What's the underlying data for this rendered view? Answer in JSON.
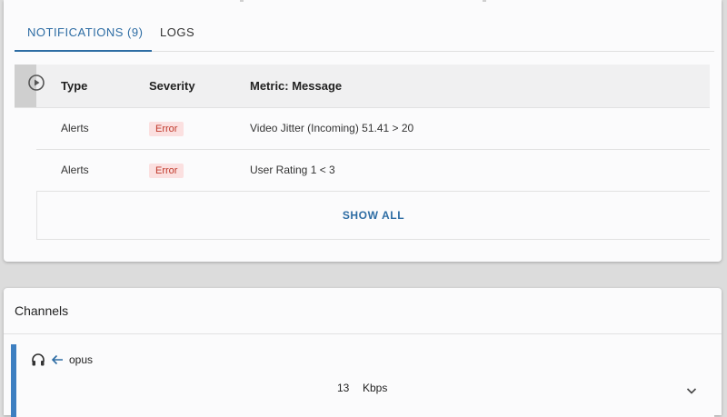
{
  "tabs": [
    {
      "label": "NOTIFICATIONS (9)",
      "active": true
    },
    {
      "label": "LOGS",
      "active": false
    }
  ],
  "table": {
    "headers": {
      "type": "Type",
      "severity": "Severity",
      "message": "Metric: Message"
    },
    "rows": [
      {
        "type": "Alerts",
        "severity": "Error",
        "message": "Video Jitter (Incoming) 51.41 > 20"
      },
      {
        "type": "Alerts",
        "severity": "Error",
        "message": "User Rating 1 < 3"
      }
    ],
    "show_all": "SHOW ALL"
  },
  "channels": {
    "title": "Channels",
    "items": [
      {
        "icon": "headphones-icon",
        "direction_icon": "arrow-left-icon",
        "codec": "opus",
        "bitrate_value": "13",
        "bitrate_unit": "Kbps"
      }
    ]
  },
  "colors": {
    "accent": "#2e6da4",
    "error_badge_bg": "#fbe0e0",
    "error_badge_text": "#c0392b",
    "channel_bar": "#3d7fc1"
  }
}
